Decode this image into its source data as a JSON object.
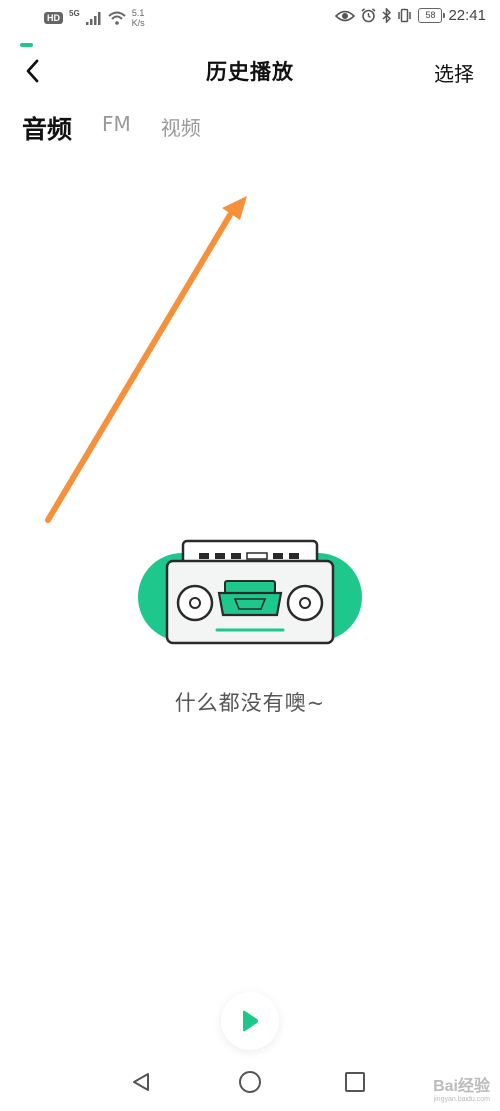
{
  "status_bar": {
    "hd": "HD",
    "network": "5G",
    "speed_value": "5.1",
    "speed_unit": "K/s",
    "battery": "58",
    "time": "22:41"
  },
  "header": {
    "title": "历史播放",
    "select_label": "选择"
  },
  "tabs": [
    {
      "label": "音频",
      "active": true
    },
    {
      "label": "FM",
      "active": false
    },
    {
      "label": "视频",
      "active": false
    }
  ],
  "empty_state": {
    "message": "什么都没有噢~",
    "icon": "radio-cassette-icon"
  },
  "player": {
    "icon": "play-icon"
  },
  "system_nav": {
    "back_icon": "triangle-back-icon",
    "home_icon": "circle-home-icon",
    "recent_icon": "square-recent-icon"
  },
  "watermark": {
    "brand": "Bai经验",
    "url": "jingyan.baidu.com"
  },
  "colors": {
    "accent": "#1ec88d",
    "arrow": "#f5913a",
    "title": "#111111",
    "tab_inactive": "#999999"
  }
}
